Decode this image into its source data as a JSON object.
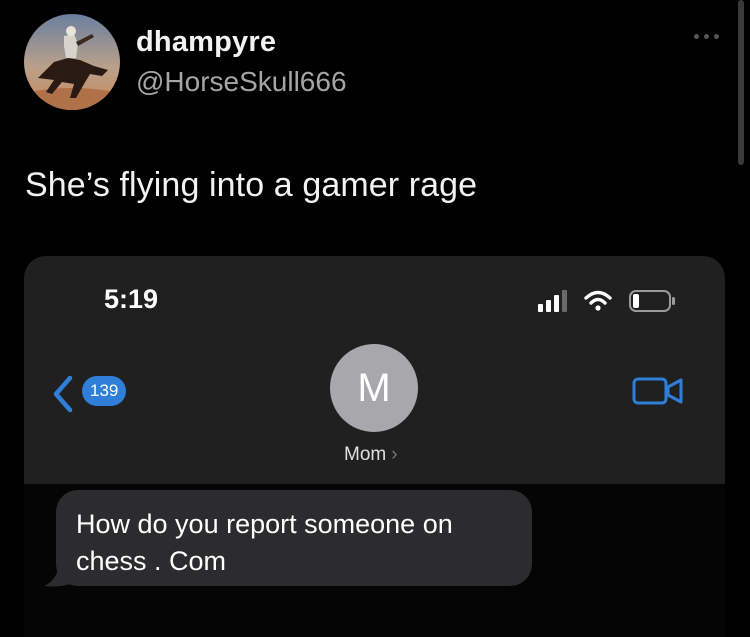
{
  "tweet": {
    "display_name": "dhampyre",
    "handle": "@HorseSkull666",
    "text": "She’s flying into a gamer rage",
    "avatar_icon": "horse-rider-avatar",
    "more_icon": "more-dots-icon"
  },
  "phone": {
    "status_time": "5:19",
    "back_badge_count": "139",
    "contact_initial": "M",
    "contact_name": "Mom",
    "contact_chevron": "›",
    "accent_color": "#2f7fd8",
    "message": "How do you report someone on chess . Com"
  }
}
